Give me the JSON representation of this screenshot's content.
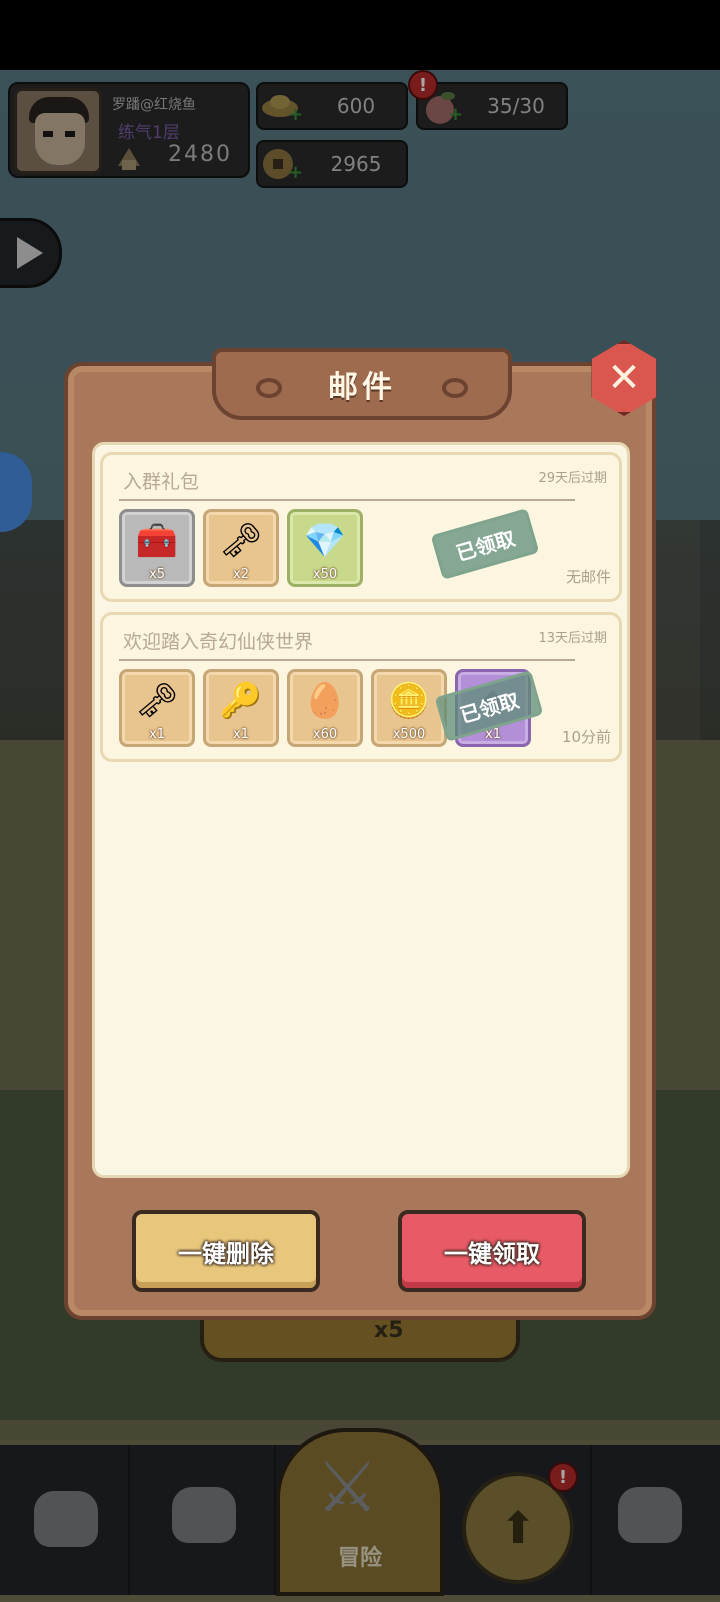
{
  "hud": {
    "player_name": "罗蹯@红烧鱼",
    "realm": "练气1层",
    "power": "2480",
    "gold": "600",
    "stamina": "35/30",
    "coins": "2965",
    "alert_mark": "!"
  },
  "modal": {
    "title": "邮件",
    "close_symbol": "✕",
    "mails": [
      {
        "title": "入群礼包",
        "expire": "29天后过期",
        "status": "无邮件",
        "stamp": "已领取",
        "items": [
          {
            "icon": "chest-icon",
            "glyph": "🧰",
            "count": "x5"
          },
          {
            "icon": "key-icon",
            "glyph": "🗝",
            "count": "x2"
          },
          {
            "icon": "crystal-icon",
            "glyph": "💎",
            "count": "x50"
          }
        ]
      },
      {
        "title": "欢迎踏入奇幻仙侠世界",
        "expire": "13天后过期",
        "status": "10分前",
        "stamp": "已领取",
        "items": [
          {
            "icon": "key-icon",
            "glyph": "🗝",
            "count": "x1"
          },
          {
            "icon": "key-icon",
            "glyph": "🔑",
            "count": "x1"
          },
          {
            "icon": "egg-icon",
            "glyph": "🥚",
            "count": "x60"
          },
          {
            "icon": "gold-ingot-icon",
            "glyph": "🪙",
            "count": "x500"
          },
          {
            "icon": "purple-item-icon",
            "glyph": "◆",
            "count": "x1"
          }
        ]
      }
    ],
    "delete_all_label": "一键删除",
    "claim_all_label": "一键领取"
  },
  "behind": {
    "label": "x5"
  },
  "bottom_nav": {
    "adventure_label": "冒险"
  }
}
